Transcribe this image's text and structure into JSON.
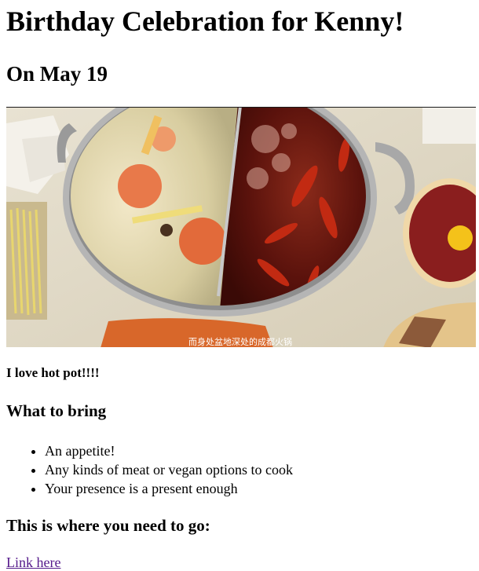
{
  "page": {
    "title": "Birthday Celebration for Kenny!",
    "date_heading": "On May 19",
    "hero_image_alt": "hot pot",
    "hero_caption": "而身处盆地深处的成都火锅",
    "tagline": "I love hot pot!!!!",
    "bring_heading": "What to bring",
    "bring_items": [
      "An appetite!",
      "Any kinds of meat or vegan options to cook",
      "Your presence is a present enough"
    ],
    "where_heading": "This is where you need to go:",
    "link_label": "Link here"
  },
  "colors": {
    "link_visited": "#551a8b",
    "text": "#000000",
    "background": "#ffffff"
  }
}
